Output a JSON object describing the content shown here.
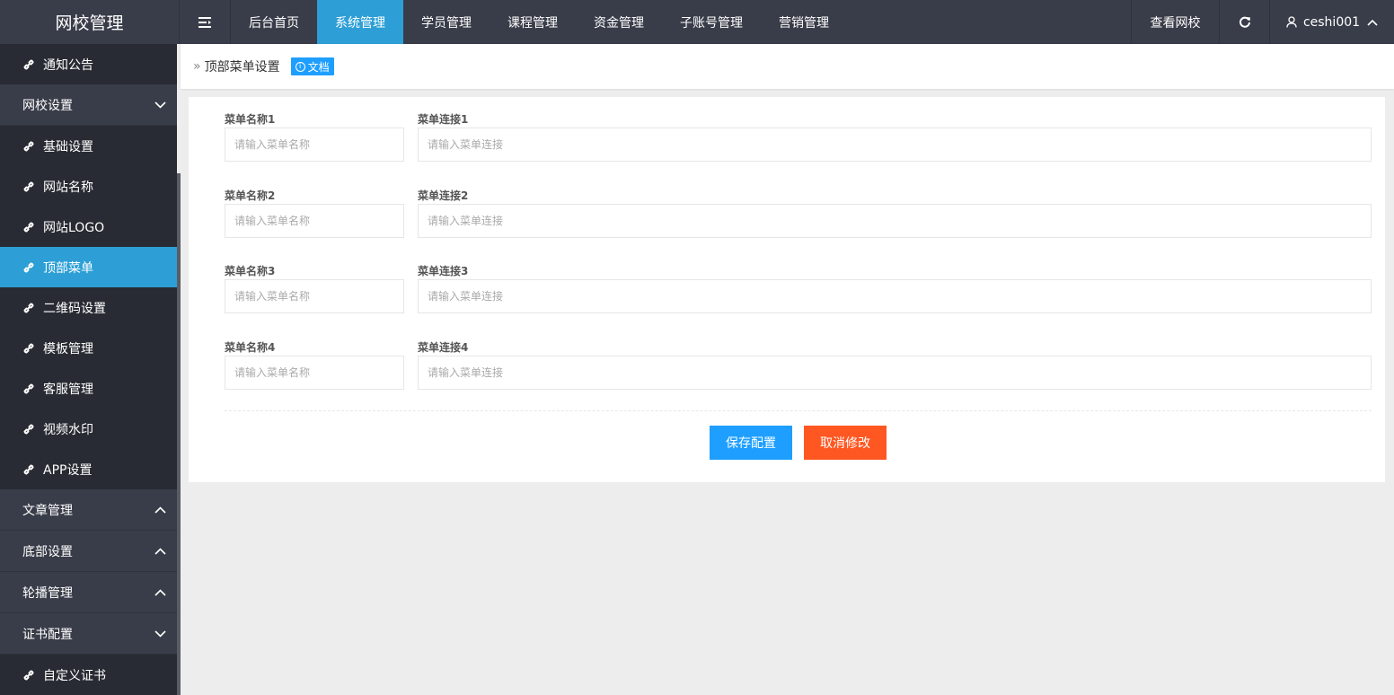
{
  "brand": "网校管理",
  "nav": {
    "toggle_icon": "menu-toggle-icon",
    "items": [
      "后台首页",
      "系统管理",
      "学员管理",
      "课程管理",
      "资金管理",
      "子账号管理",
      "营销管理"
    ],
    "active_index": 1,
    "view_school": "查看网校",
    "refresh_icon": "refresh-icon",
    "user": "ceshi001",
    "accent": "#2d9fd6"
  },
  "sidebar": {
    "top_links": [
      "通知公告"
    ],
    "group_site": "网校设置",
    "site_links": [
      "基础设置",
      "网站名称",
      "网站LOGO",
      "顶部菜单",
      "二维码设置",
      "模板管理",
      "客服管理",
      "视频水印",
      "APP设置"
    ],
    "active_link": "顶部菜单",
    "group_article": "文章管理",
    "group_footer": "底部设置",
    "group_carousel": "轮播管理",
    "group_cert": "证书配置",
    "cert_links": [
      "自定义证书"
    ]
  },
  "breadcrumb": {
    "title": "顶部菜单设置",
    "doc_label": "文档"
  },
  "form": {
    "rows": [
      {
        "name_label": "菜单名称1",
        "link_label": "菜单连接1",
        "name_value": "",
        "link_value": ""
      },
      {
        "name_label": "菜单名称2",
        "link_label": "菜单连接2",
        "name_value": "",
        "link_value": ""
      },
      {
        "name_label": "菜单名称3",
        "link_label": "菜单连接3",
        "name_value": "",
        "link_value": ""
      },
      {
        "name_label": "菜单名称4",
        "link_label": "菜单连接4",
        "name_value": "",
        "link_value": ""
      }
    ],
    "name_placeholder": "请输入菜单名称",
    "link_placeholder": "请输入菜单连接",
    "save_label": "保存配置",
    "cancel_label": "取消修改",
    "save_color": "#1e9fff",
    "cancel_color": "#ff5722"
  }
}
